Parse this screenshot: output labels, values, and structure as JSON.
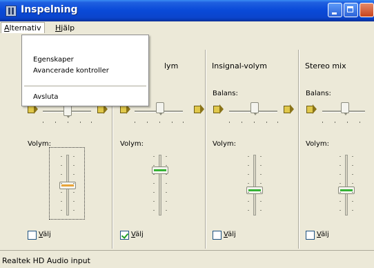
{
  "window": {
    "title": "Inspelning"
  },
  "menubar": {
    "options": "Alternativ",
    "help": "Hjälp"
  },
  "dropdown": {
    "items": [
      "Egenskaper",
      "Avancerade kontroller",
      "Avsluta"
    ]
  },
  "columns": [
    {
      "title": "",
      "balance_label": "",
      "volume_label": "Volym:",
      "select_label": "Välj",
      "selected": false,
      "volume": 0.5
    },
    {
      "title": "lym",
      "balance_label": "",
      "volume_label": "Volym:",
      "select_label": "Välj",
      "selected": true,
      "volume": 0.78
    },
    {
      "title": "Insignal-volym",
      "balance_label": "Balans:",
      "volume_label": "Volym:",
      "select_label": "Välj",
      "selected": false,
      "volume": 0.4
    },
    {
      "title": "Stereo mix",
      "balance_label": "Balans:",
      "volume_label": "Volym:",
      "select_label": "Välj",
      "selected": false,
      "volume": 0.4
    }
  ],
  "status": {
    "text": "Realtek HD Audio input"
  },
  "icons": [
    "window-icon",
    "minimize-icon",
    "maximize-icon",
    "close-icon",
    "speaker-left-icon",
    "speaker-right-icon"
  ]
}
